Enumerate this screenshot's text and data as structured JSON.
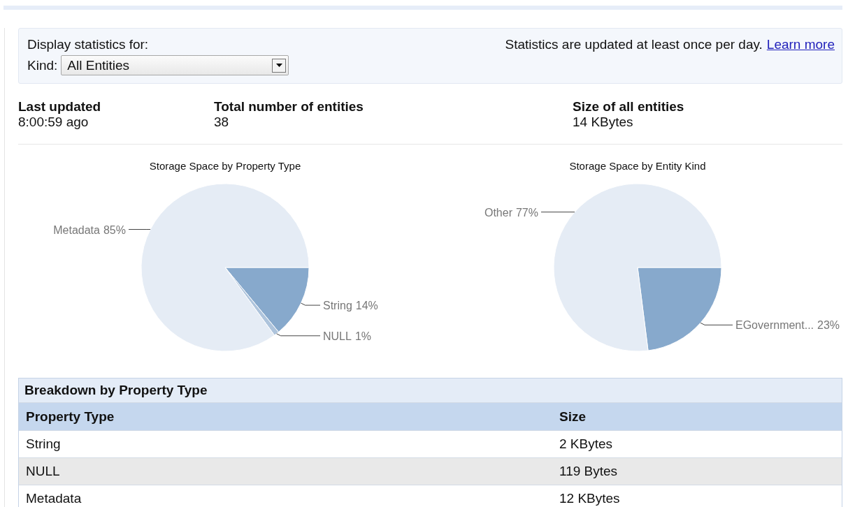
{
  "filter": {
    "heading": "Display statistics for:",
    "kind_label": "Kind:",
    "kind_value": "All Entities",
    "notice": "Statistics are updated at least once per day.",
    "link": "Learn more"
  },
  "stats": [
    {
      "label": "Last updated",
      "value": "8:00:59 ago"
    },
    {
      "label": "Total number of entities",
      "value": "38"
    },
    {
      "label": "Size of all entities",
      "value": "14 KBytes"
    }
  ],
  "charts": [
    {
      "chart_data": {
        "type": "pie",
        "title": "Storage Space by Property Type",
        "categories": [
          "String",
          "NULL",
          "Metadata"
        ],
        "values": [
          14,
          1,
          85
        ],
        "data_labels": "value_labels",
        "value_labels": [
          "14%",
          "1%",
          "85%"
        ]
      }
    },
    {
      "chart_data": {
        "type": "pie",
        "title": "Storage Space by Entity Kind",
        "categories": [
          "EGovernment...",
          "Other"
        ],
        "values": [
          23,
          77
        ],
        "data_labels": "value_labels",
        "value_labels": [
          "23%",
          "77%"
        ]
      }
    }
  ],
  "table": {
    "title": "Breakdown by Property Type",
    "columns": [
      "Property Type",
      "Size"
    ],
    "rows": [
      [
        "String",
        "2 KBytes"
      ],
      [
        "NULL",
        "119 Bytes"
      ],
      [
        "Metadata",
        "12 KBytes"
      ]
    ]
  }
}
